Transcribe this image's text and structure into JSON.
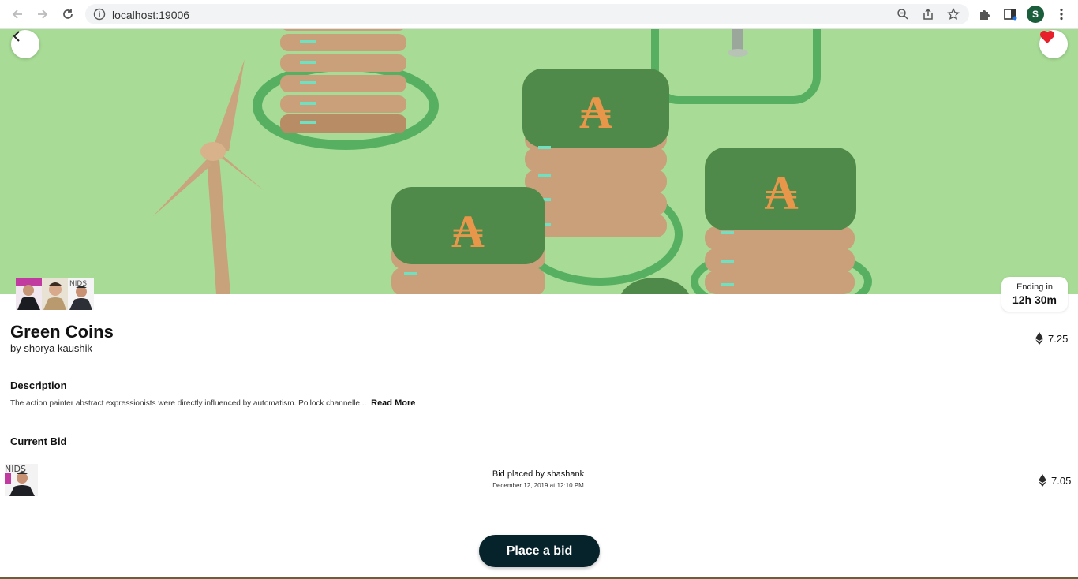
{
  "browser": {
    "url": "localhost:19006",
    "profile_initial": "S"
  },
  "nft": {
    "title": "Green Coins",
    "byline": "by shorya kaushik",
    "price": "7.25",
    "ending_label": "Ending in",
    "ending_value": "12h 30m",
    "owner_avatars": [
      "owner-avatar-1",
      "owner-avatar-2",
      "owner-avatar-3"
    ]
  },
  "description": {
    "heading": "Description",
    "text": "The action painter abstract expressionists were directly influenced by automatism. Pollock channelle...",
    "read_more": "Read More"
  },
  "current_bid": {
    "heading": "Current Bid",
    "placed_by": "Bid placed by shashank",
    "date": "December 12, 2019 at 12:10 PM",
    "amount": "7.05"
  },
  "actions": {
    "place_bid": "Place a bid"
  },
  "colors": {
    "hero_bg": "#a8dc96",
    "button_bg": "#06222b",
    "heart": "#e8202a",
    "coin_top": "#4f8a4a",
    "coin_symbol": "#e8974a"
  }
}
